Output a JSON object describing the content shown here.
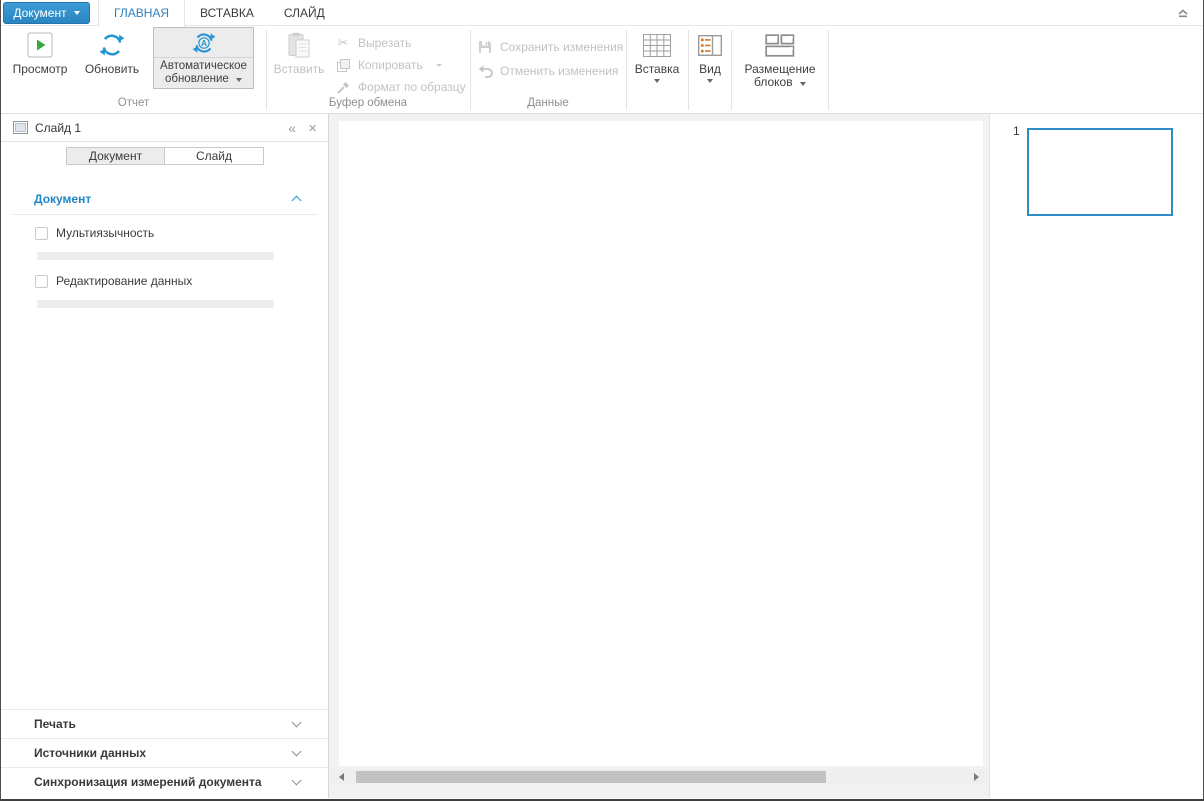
{
  "colors": {
    "accent_blue": "#2e8fcc",
    "icon_blue": "#2596d2",
    "thumb_border": "#2e8bc5",
    "orange": "#d2771e",
    "green": "#3aa83f"
  },
  "app_menu": {
    "label": "Документ"
  },
  "ribbon_tabs": {
    "home": "ГЛАВНАЯ",
    "insert": "ВСТАВКА",
    "slide": "СЛАЙД"
  },
  "ribbon": {
    "preview_label": "Просмотр",
    "refresh_label": "Обновить",
    "auto_refresh_line1": "Автоматическое",
    "auto_refresh_line2": "обновление",
    "paste_label": "Вставить",
    "cut_label": "Вырезать",
    "copy_label": "Копировать",
    "format_painter_label": "Формат по образцу",
    "save_changes_label": "Сохранить изменения",
    "undo_changes_label": "Отменить изменения",
    "insert_label": "Вставка",
    "view_label": "Вид",
    "layout_line1": "Размещение",
    "layout_line2": "блоков",
    "group_report": "Отчет",
    "group_clipboard": "Буфер обмена",
    "group_data": "Данные"
  },
  "side_panel": {
    "title": "Слайд 1",
    "tab_document": "Документ",
    "tab_slide": "Слайд",
    "section_document": "Документ",
    "option_multilanguage": "Мультиязычность",
    "option_data_editing": "Редактирование данных",
    "section_print": "Печать",
    "section_data_sources": "Источники данных",
    "section_sync": "Синхронизация измерений документа"
  },
  "slide_list": {
    "slide1_number": "1"
  },
  "icons": {
    "auto_letter": "A",
    "cut_glyph": "✂",
    "collapse_glyph": "«",
    "close_glyph": "×"
  }
}
